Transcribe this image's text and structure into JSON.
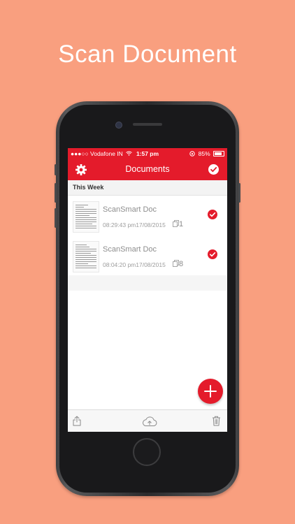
{
  "headline": "Scan Document",
  "status_bar": {
    "carrier": "●●●○○ Vodafone IN",
    "time": "1:57 pm",
    "battery": "85%"
  },
  "nav": {
    "title": "Documents"
  },
  "section_header": "This Week",
  "documents": [
    {
      "name": "ScanSmart Doc",
      "date": "08:29:43 pm17/08/2015",
      "pages": "1"
    },
    {
      "name": "ScanSmart Doc",
      "date": "08:04:20 pm17/08/2015",
      "pages": "8"
    }
  ],
  "colors": {
    "background": "#F99F7F",
    "accent": "#E41B2B"
  },
  "icons": {
    "nav_left": "gear-icon",
    "nav_right": "check-circle-icon",
    "row_check": "check-circle-icon",
    "fab": "plus-icon",
    "toolbar": [
      "share-icon",
      "cloud-upload-icon",
      "trash-icon"
    ]
  }
}
